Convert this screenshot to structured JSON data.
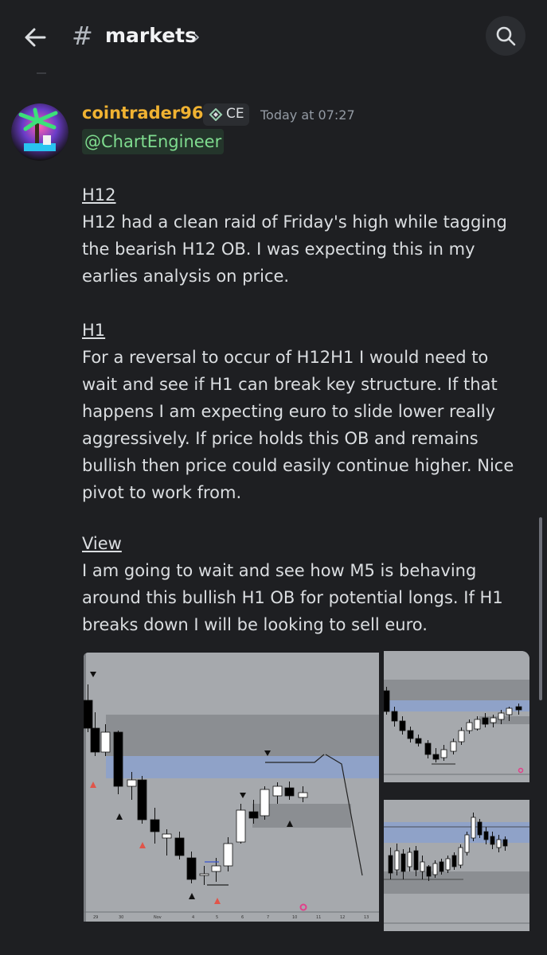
{
  "header": {
    "channel_name": "markets",
    "hash_symbol": "#",
    "chevron": "›"
  },
  "message": {
    "username": "cointrader96",
    "username_color": "#f0b232",
    "tag": "CE",
    "timestamp": "Today at 07:27",
    "mention": "@ChartEngineer",
    "sections": [
      {
        "heading": "H12",
        "text": "H12 had a clean raid of Friday's high while tagging the bearish H12 OB. I was expecting this in my earlies analysis on price."
      },
      {
        "heading": "H1",
        "text": "For a reversal to occur of H12H1 I would need to wait and see if H1 can break key structure. If that happens I am expecting euro to slide lower really aggressively. If price holds this OB and remains bullish then price could easily continue higher. Nice pivot to work from."
      },
      {
        "heading": "View",
        "text": "I am going to wait and see how M5 is behaving around this bullish H1 OB for potential longs. If H1 breaks down I will be looking to sell euro."
      }
    ]
  },
  "attachments": {
    "main_chart_xlabels": [
      "29",
      "30",
      "Nov",
      "4",
      "5",
      "6",
      "7",
      "10",
      "11",
      "12",
      "13"
    ]
  },
  "icons": {
    "back": "arrow-left-icon",
    "search": "search-icon",
    "tag": "diamond-icon"
  },
  "colors": {
    "background": "#1e1f22",
    "mention_bg": "#24352b",
    "mention_text": "#7fdc8f",
    "chart_bg": "#a6a9ad",
    "ob_band": "#8fa2c8"
  }
}
